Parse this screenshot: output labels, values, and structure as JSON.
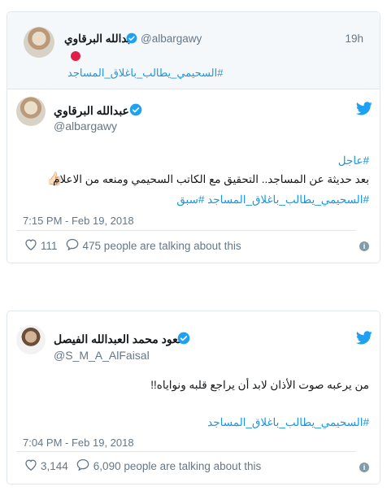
{
  "colors": {
    "link": "#1b95e0",
    "muted": "#657786",
    "verified": "#1da1f2",
    "twitter": "#1da1f2"
  },
  "tweet1": {
    "parent": {
      "name": "عبدالله البرقاوي",
      "handle": "@albargawy",
      "time": "19h",
      "emoji": "red-circle",
      "hashtag": "#السحيمي_يطالب_باغلاق_المساجد"
    },
    "author": {
      "name": "عبدالله البرقاوي",
      "handle": "@albargawy",
      "verified": true
    },
    "hashtag_top": "#عاجل",
    "text": "بعد حديثة عن المساجد.. التحقيق مع الكاتب السحيمي ومنعه من الاعلام",
    "emoji": "👍🏻",
    "hashtags_bottom": "#السحيمي_يطالب_باغلاق_المساجد #سبق",
    "date": "7:15 PM - Feb 19, 2018",
    "likes": "111",
    "talking": "475 people are talking about this"
  },
  "tweet2": {
    "author": {
      "name": "سعود محمد العبدالله الفيصل",
      "handle": "@S_M_A_AlFaisal",
      "verified": true
    },
    "text": "من يرعبه صوت الأذان لابد أن يراجع قلبه ونواياه!!",
    "hashtag": "#السحيمي_يطالب_باغلاق_المساجد",
    "date": "7:04 PM - Feb 19, 2018",
    "likes": "3,144",
    "talking": "6,090 people are talking about this"
  }
}
